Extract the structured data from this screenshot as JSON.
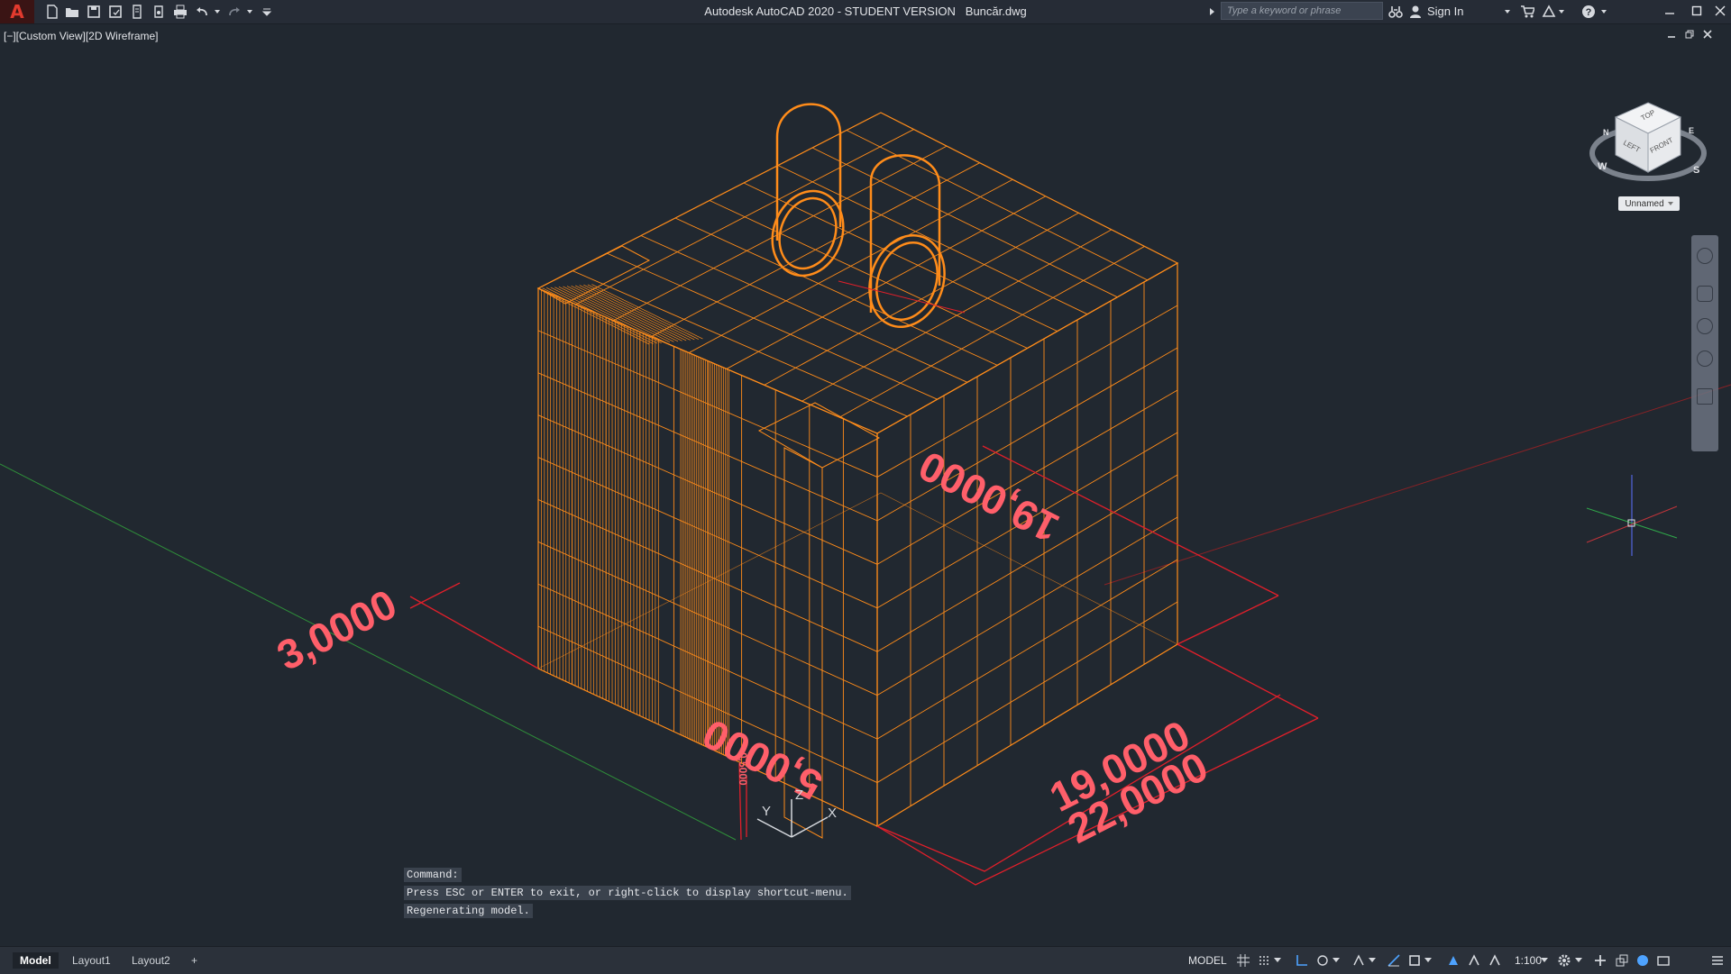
{
  "titlebar": {
    "app_logo": "A",
    "app_name": "Autodesk AutoCAD 2020 - STUDENT VERSION",
    "file_name": "Buncăr.dwg",
    "search_placeholder": "Type a keyword or phrase",
    "sign_in": "Sign In",
    "icons": [
      "new-icon",
      "open-icon",
      "save-icon",
      "save-as-icon",
      "publish-icon",
      "plot-icon",
      "print-icon",
      "undo-icon",
      "redo-icon",
      "customize-icon"
    ]
  },
  "viewport": {
    "controls_label": "[−][Custom View][2D Wireframe]",
    "viewcube": {
      "top": "TOP",
      "left": "LEFT",
      "front": "FRONT",
      "compass_n": "N",
      "compass_w": "W",
      "compass_s": "S",
      "compass_e": "E"
    },
    "wcs_label": "Unnamed",
    "ucs": {
      "x": "X",
      "y": "Y",
      "z": "Z"
    },
    "dimensions": [
      "3,0000",
      "5,0000",
      "19,0000",
      "19,0000",
      "22,0000"
    ],
    "small_dimension": "0,5000"
  },
  "command": {
    "history": [
      "Command:",
      "Press ESC or ENTER to exit, or right-click to display shortcut-menu.",
      "Regenerating model."
    ],
    "input_value": ""
  },
  "statusbar": {
    "tabs": [
      "Model",
      "Layout1",
      "Layout2"
    ],
    "add_tab": "+",
    "model_label": "MODEL",
    "scale": "1:100"
  },
  "colors": {
    "background": "#212830",
    "wire": "#ff8c1a",
    "dimension": "#ff5f6a",
    "dimension_line": "#e21f2a"
  }
}
